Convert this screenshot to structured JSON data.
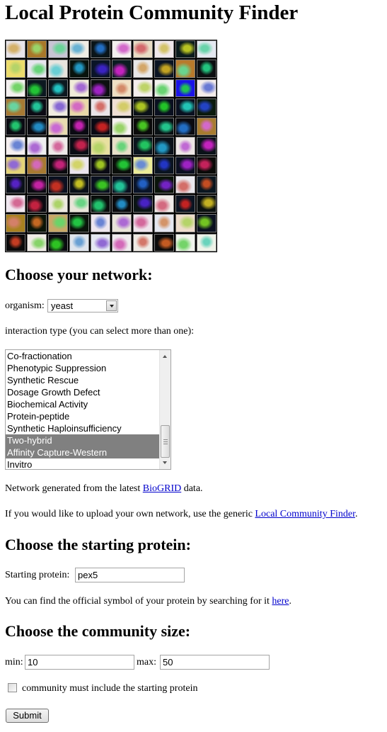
{
  "page": {
    "title": "Local Protein Community Finder"
  },
  "mosaic": {
    "description": "Grid of protein structure images",
    "columns": 10,
    "rows": 11,
    "tile_colors": [
      [
        "#e8e4ea",
        "#a8782a",
        "#c8c4d4",
        "#f0ece4",
        "#0a1418",
        "#f4f0ee",
        "#e8dcc4",
        "#f0e8ec",
        "#0a1a1c",
        "#e4e8f0"
      ],
      [
        "#ecdc6c",
        "#e6e4ee",
        "#e8e4de",
        "#08120c",
        "#0a1428",
        "#0a1c20",
        "#e8e8e8",
        "#0a1424",
        "#b87a2c",
        "#0c0e10"
      ],
      [
        "#f4f0f0",
        "#0c1820",
        "#0c1820",
        "#f0ecd8",
        "#0c1010",
        "#f0e0c4",
        "#f4eeee",
        "#f2f2ee",
        "#1a14e8",
        "#f4ecea"
      ],
      [
        "#a87a34",
        "#0c0a14",
        "#f0ece0",
        "#e8d8a8",
        "#eae4e8",
        "#f0e0d4",
        "#0a1018",
        "#0a1020",
        "#0a1020",
        "#0a1a0c"
      ],
      [
        "#0a0a12",
        "#0a0a10",
        "#e8dcb0",
        "#0a0a12",
        "#0a0a14",
        "#f6f2f0",
        "#0a0a0a",
        "#0a1014",
        "#0a0a10",
        "#a87c30"
      ],
      [
        "#f6f0f0",
        "#eeeef0",
        "#eeeae8",
        "#0a0c14",
        "#e8e0a0",
        "#e8e0c8",
        "#0a141c",
        "#0a1018",
        "#ece6e4",
        "#0a1218"
      ],
      [
        "#e4d478",
        "#a87a32",
        "#0a0a0e",
        "#ebe4ee",
        "#0a0a14",
        "#0a0e0a",
        "#ecec98",
        "#0a1420",
        "#0a1020",
        "#0a0a08"
      ],
      [
        "#0a1018",
        "#0a0a10",
        "#0a1020",
        "#0a1018",
        "#0a1020",
        "#0a1020",
        "#0a1428",
        "#0a140a",
        "#e8e8ee",
        "#0a1620"
      ],
      [
        "#f0e8f0",
        "#0a0a10",
        "#ece8e0",
        "#e8e4d8",
        "#0a0e0c",
        "#0a0a0c",
        "#0a1414",
        "#eeeae8",
        "#0a1422",
        "#0a1010"
      ],
      [
        "#a88220",
        "#0a1408",
        "#c8a868",
        "#0a120a",
        "#ede6ee",
        "#e8e4d8",
        "#eee4ec",
        "#e4e6f0",
        "#eedccc",
        "#0a1020"
      ],
      [
        "#0a0a0a",
        "#f0ece6",
        "#0a0a10",
        "#dee4ec",
        "#e4e8f2",
        "#eeebee",
        "#eeeae4",
        "#0a0a0a",
        "#f0f4ec",
        "#eef2e8"
      ]
    ],
    "caption": "protein structures"
  },
  "network_section": {
    "heading": "Choose your network:",
    "organism_label": "organism:",
    "organism_value": "yeast",
    "interaction_label": "interaction type (you can select more than one):",
    "interaction_options": [
      {
        "label": "Co-fractionation",
        "selected": false
      },
      {
        "label": "Phenotypic Suppression",
        "selected": false
      },
      {
        "label": "Synthetic Rescue",
        "selected": false
      },
      {
        "label": "Dosage Growth Defect",
        "selected": false
      },
      {
        "label": "Biochemical Activity",
        "selected": false
      },
      {
        "label": "Protein-peptide",
        "selected": false
      },
      {
        "label": "Synthetic Haploinsufficiency",
        "selected": false
      },
      {
        "label": "Two-hybrid",
        "selected": true
      },
      {
        "label": "Affinity Capture-Western",
        "selected": true
      },
      {
        "label": "Invitro",
        "selected": false
      }
    ],
    "biogrid_prefix": "Network generated from the latest ",
    "biogrid_link": "BioGRID",
    "biogrid_suffix": " data.",
    "upload_prefix": "If you would like to upload your own network, use the generic ",
    "upload_link": "Local Community Finder",
    "upload_suffix": "."
  },
  "protein_section": {
    "heading": "Choose the starting protein:",
    "starting_label": "Starting protein:",
    "starting_value": "pex5",
    "help_prefix": "You can find the official symbol of your protein by searching for it ",
    "help_link": "here",
    "help_suffix": "."
  },
  "size_section": {
    "heading": "Choose the community size:",
    "min_label": "min:",
    "min_value": "10",
    "max_label": "max:",
    "max_value": "50",
    "include_label": "community must include the starting protein",
    "include_checked": false
  },
  "submit_label": "Submit"
}
